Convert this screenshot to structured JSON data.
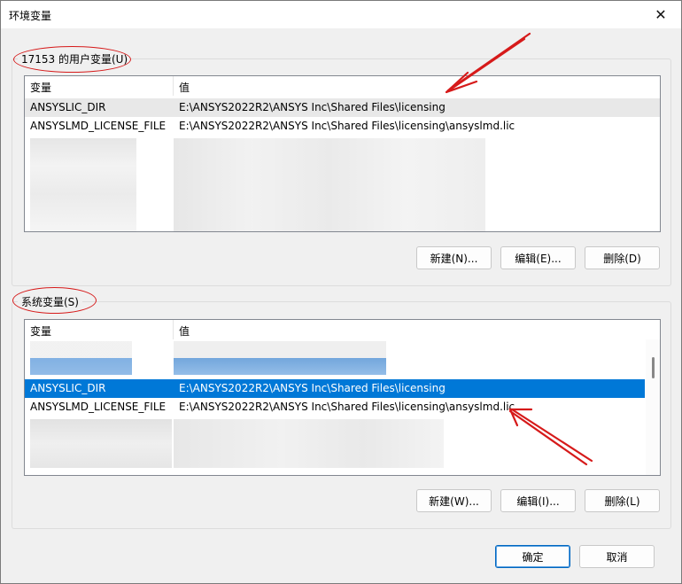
{
  "window": {
    "title": "环境变量",
    "close_glyph": "✕"
  },
  "user_group": {
    "legend": "17153 的用户变量(U)",
    "col_var": "变量",
    "col_val": "值",
    "rows": [
      {
        "name": "ANSYSLIC_DIR",
        "value": "E:\\ANSYS2022R2\\ANSYS Inc\\Shared Files\\licensing"
      },
      {
        "name": "ANSYSLMD_LICENSE_FILE",
        "value": "E:\\ANSYS2022R2\\ANSYS Inc\\Shared Files\\licensing\\ansyslmd.lic"
      }
    ],
    "new_label": "新建(N)...",
    "edit_label": "编辑(E)...",
    "delete_label": "删除(D)"
  },
  "system_group": {
    "legend": "系统变量(S)",
    "col_var": "变量",
    "col_val": "值",
    "rows": [
      {
        "name": "ANSYSLIC_DIR",
        "value": "E:\\ANSYS2022R2\\ANSYS Inc\\Shared Files\\licensing"
      },
      {
        "name": "ANSYSLMD_LICENSE_FILE",
        "value": "E:\\ANSYS2022R2\\ANSYS Inc\\Shared Files\\licensing\\ansyslmd.lic"
      }
    ],
    "new_label": "新建(W)...",
    "edit_label": "编辑(I)...",
    "delete_label": "删除(L)"
  },
  "footer": {
    "ok_label": "确定",
    "cancel_label": "取消"
  },
  "colors": {
    "selection": "#0078d7",
    "annotation": "#d61a1a"
  }
}
